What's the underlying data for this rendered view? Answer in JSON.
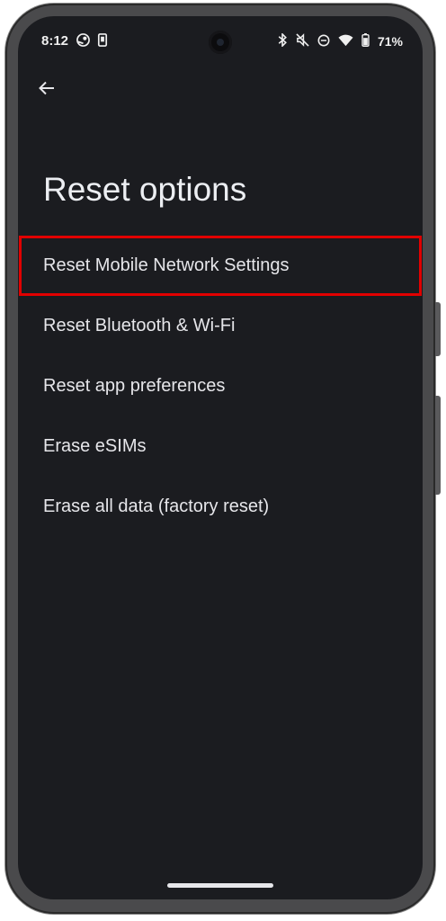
{
  "status_bar": {
    "time": "8:12",
    "battery_percent": "71%",
    "left_icons": [
      "steam-icon",
      "device-icon"
    ],
    "right_icons": [
      "bluetooth-icon",
      "mute-icon",
      "dnd-icon",
      "wifi-icon",
      "battery-icon"
    ]
  },
  "header": {
    "back_icon": "arrow-back-icon",
    "title": "Reset options"
  },
  "options": [
    {
      "label": "Reset Mobile Network Settings",
      "highlighted": true
    },
    {
      "label": "Reset Bluetooth & Wi-Fi",
      "highlighted": false
    },
    {
      "label": "Reset app preferences",
      "highlighted": false
    },
    {
      "label": "Erase eSIMs",
      "highlighted": false
    },
    {
      "label": "Erase all data (factory reset)",
      "highlighted": false
    }
  ],
  "colors": {
    "background": "#1b1c20",
    "text": "#e6e6ea",
    "highlight_border": "#e10000"
  }
}
